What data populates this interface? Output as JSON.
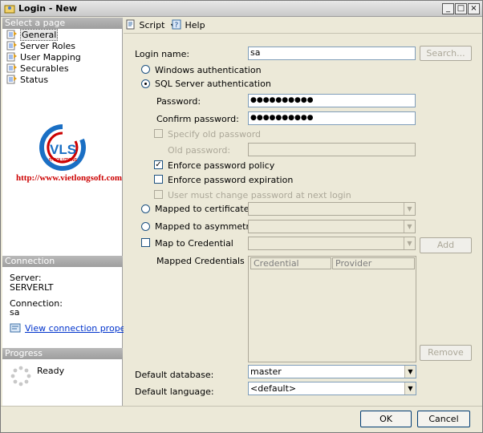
{
  "window": {
    "title": "Login - New",
    "controls": {
      "minimize": "_",
      "maximize": "□",
      "close": "×"
    }
  },
  "left": {
    "select_page_header": "Select a page",
    "nav_items": [
      "General",
      "Server Roles",
      "User Mapping",
      "Securables",
      "Status"
    ],
    "logo": {
      "letters": "VLS",
      "sub": "IT SOLUTIONS",
      "url_text": "http://www.vietlongsoft.com",
      "ring_color": "#1a6fc4",
      "url_color": "#cc0000"
    },
    "connection_header": "Connection",
    "server_label": "Server:",
    "server_value": "SERVERLT",
    "connection_label": "Connection:",
    "connection_value": "sa",
    "view_props_link": "View connection properties",
    "progress_header": "Progress",
    "progress_status": "Ready"
  },
  "toolbar": {
    "script_label": "Script",
    "help_label": "Help"
  },
  "form": {
    "login_name_label": "Login name:",
    "login_name_value": "sa",
    "search_button": "Search...",
    "windows_auth": "Windows authentication",
    "sql_auth": "SQL Server authentication",
    "password_label": "Password:",
    "password_value": "●●●●●●●●●●",
    "confirm_password_label": "Confirm password:",
    "confirm_password_value": "●●●●●●●●●●",
    "specify_old_password": "Specify old password",
    "old_password_label": "Old password:",
    "enforce_policy": "Enforce password policy",
    "enforce_expiration": "Enforce password expiration",
    "must_change": "User must change password at next login",
    "mapped_certificate": "Mapped to certificate",
    "mapped_asym_key": "Mapped to asymmetric key",
    "map_credential": "Map to Credential",
    "add_button": "Add",
    "mapped_credentials_label": "Mapped Credentials",
    "grid_columns": [
      "Credential",
      "Provider"
    ],
    "remove_button": "Remove",
    "default_database_label": "Default database:",
    "default_database_value": "master",
    "default_language_label": "Default language:",
    "default_language_value": "<default>"
  },
  "footer": {
    "ok_button": "OK",
    "cancel_button": "Cancel"
  }
}
